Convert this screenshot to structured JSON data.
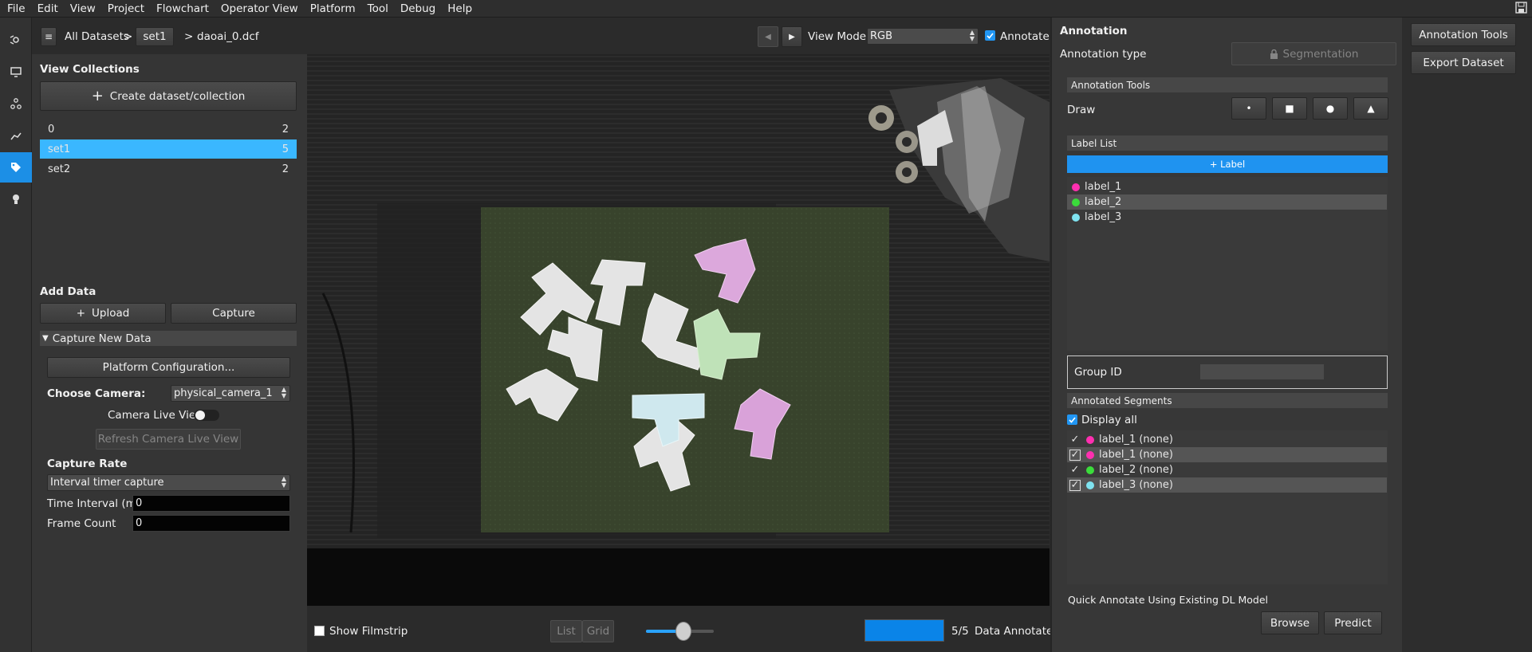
{
  "menu": [
    "File",
    "Edit",
    "View",
    "Project",
    "Flowchart",
    "Operator View",
    "Platform",
    "Tool",
    "Debug",
    "Help"
  ],
  "breadcrumb": {
    "root": "All Datasets",
    "sep": ">",
    "dataset": "set1",
    "file": "daoai_0.dcf"
  },
  "view_mode": {
    "label": "View Mode:",
    "value": "RGB"
  },
  "annotate_label": "Annotate",
  "left": {
    "view_collections": "View Collections",
    "create_btn": "Create dataset/collection",
    "collections": [
      {
        "name": "0",
        "count": "2"
      },
      {
        "name": "set1",
        "count": "5"
      },
      {
        "name": "set2",
        "count": "2"
      }
    ],
    "add_data": "Add Data",
    "upload": "Upload",
    "capture": "Capture",
    "capture_new": "Capture New Data",
    "platform_config": "Platform Configuration...",
    "choose_camera": "Choose Camera:",
    "camera": "physical_camera_1",
    "live_view": "Camera Live View",
    "refresh_live": "Refresh Camera Live View",
    "capture_rate": "Capture Rate",
    "rate_mode": "Interval timer capture",
    "time_interval_label": "Time Interval (ms)",
    "time_interval": "0",
    "frame_count_label": "Frame Count",
    "frame_count": "0"
  },
  "bottom": {
    "show_filmstrip": "Show Filmstrip",
    "list": "List",
    "grid": "Grid",
    "progress_text": "5/5",
    "annotated": "Data Annotated",
    "slider_level": 0.55,
    "progress": 1.0
  },
  "annotation": {
    "title": "Annotation",
    "type_label": "Annotation type",
    "type_value": "Segmentation",
    "tools_header": "Annotation Tools",
    "draw": "Draw",
    "label_list_header": "Label List",
    "add_label": "+ Label",
    "labels": [
      {
        "name": "label_1",
        "color": "#ff2fb0"
      },
      {
        "name": "label_2",
        "color": "#3bdc3b"
      },
      {
        "name": "label_3",
        "color": "#7fe3f0"
      }
    ],
    "group_id": "Group ID",
    "segments_header": "Annotated Segments",
    "display_all": "Display all",
    "segments": [
      {
        "text": "label_1 (none)",
        "color": "#ff2fb0"
      },
      {
        "text": "label_1 (none)",
        "color": "#ff2fb0"
      },
      {
        "text": "label_2 (none)",
        "color": "#3bdc3b"
      },
      {
        "text": "label_3 (none)",
        "color": "#7fe3f0"
      }
    ],
    "quick": "Quick Annotate Using Existing DL Model",
    "browse": "Browse",
    "predict": "Predict"
  },
  "far": {
    "annotation_tools": "Annotation Tools",
    "export": "Export Dataset"
  },
  "colors": {
    "accent": "#1c8fe6",
    "selection": "#3ab7ff"
  }
}
